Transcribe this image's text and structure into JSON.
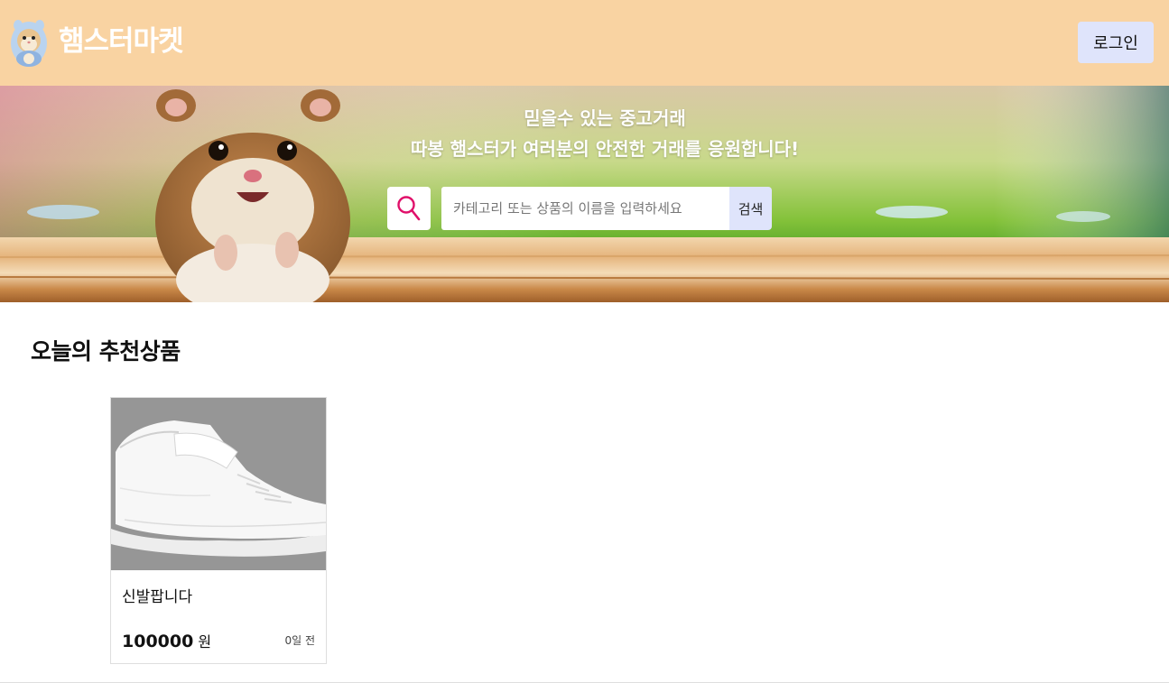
{
  "header": {
    "logo_text": "햄스터마켓",
    "login_label": "로그인",
    "background_color": "#f9d3a2"
  },
  "banner": {
    "line1": "믿을수 있는 중고거래",
    "line2": "따봉 햄스터가 여러분의 안전한 거래를 응원합니다!",
    "search": {
      "placeholder": "카테고리 또는 상품의 이름을 입력하세요",
      "value": "",
      "button_label": "검색",
      "icon": "search-icon",
      "icon_color": "#e0106a"
    }
  },
  "section": {
    "title": "오늘의 추천상품"
  },
  "products": [
    {
      "name": "신발팝니다",
      "price": "100000",
      "unit": "원",
      "time": "0일 전",
      "image": "white-sneaker"
    }
  ],
  "colors": {
    "accent_button": "#dfe4fb"
  }
}
